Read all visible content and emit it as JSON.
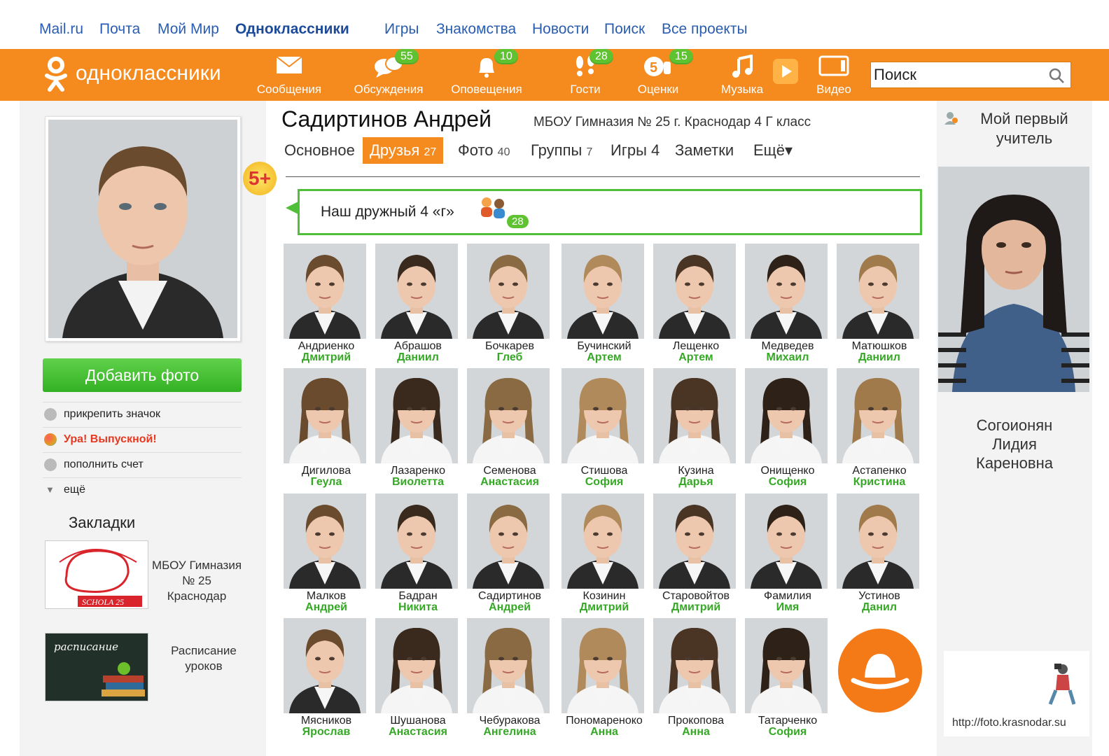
{
  "portal_nav": [
    "Mail.ru",
    "Почта",
    "Мой Мир",
    "Одноклассники",
    "Игры",
    "Знакомства",
    "Новости",
    "Поиск",
    "Все проекты"
  ],
  "header": {
    "logo_text": "одноклассники",
    "nav": [
      {
        "label": "Сообщения",
        "icon": "envelope-icon",
        "badge": ""
      },
      {
        "label": "Обсуждения",
        "icon": "chat-bubbles-icon",
        "badge": "55"
      },
      {
        "label": "Оповещения",
        "icon": "bell-icon",
        "badge": "10"
      },
      {
        "label": "Гости",
        "icon": "footprints-icon",
        "badge": "28"
      },
      {
        "label": "Оценки",
        "icon": "rating-icon",
        "badge": "15"
      },
      {
        "label": "Музыка",
        "icon": "music-note-icon",
        "badge": ""
      },
      {
        "label": "Видео",
        "icon": "video-icon",
        "badge": ""
      }
    ],
    "search_value": "Поиск"
  },
  "profile": {
    "name": "Садиртинов Андрей",
    "school": "МБОУ Гимназия № 25 г. Краснодар 4 Г класс",
    "age_badge": "5+",
    "add_photo": "Добавить фото",
    "menu": [
      "прикрепить значок",
      "Ура! Выпускной!",
      "пополнить счет",
      "ещё"
    ]
  },
  "bookmarks": {
    "title": "Закладки",
    "items": [
      {
        "text": "МБОУ Гимназия № 25 Краснодар",
        "image_text": "SCHOLA 25"
      },
      {
        "text": "Расписание уроков",
        "image_text": "расписание"
      }
    ]
  },
  "tabs": [
    {
      "label": "Основное",
      "count": ""
    },
    {
      "label": "Друзья",
      "count": "27"
    },
    {
      "label": "Фото",
      "count": "40"
    },
    {
      "label": "Группы",
      "count": "7"
    },
    {
      "label": "Игры",
      "count": "4"
    },
    {
      "label": "Заметки",
      "count": ""
    },
    {
      "label": "Ещё▾",
      "count": ""
    }
  ],
  "group": {
    "title": "Наш дружный 4 «г»",
    "count": "28"
  },
  "friends": [
    {
      "last": "Андриенко",
      "first": "Дмитрий"
    },
    {
      "last": "Абрашов",
      "first": "Даниил"
    },
    {
      "last": "Бочкарев",
      "first": "Глеб"
    },
    {
      "last": "Бучинский",
      "first": "Артем"
    },
    {
      "last": "Лещенко",
      "first": "Артем"
    },
    {
      "last": "Медведев",
      "first": "Михаил"
    },
    {
      "last": "Матюшков",
      "first": "Даниил"
    },
    {
      "last": "Дигилова",
      "first": "Геула"
    },
    {
      "last": "Лазаренко",
      "first": "Виолетта"
    },
    {
      "last": "Семенова",
      "first": "Анастасия"
    },
    {
      "last": "Стишова",
      "first": "София"
    },
    {
      "last": "Кузина",
      "first": "Дарья"
    },
    {
      "last": "Онищенко",
      "first": "София"
    },
    {
      "last": "Астапенко",
      "first": "Кристина"
    },
    {
      "last": "Малков",
      "first": "Андрей"
    },
    {
      "last": "Бадран",
      "first": "Никита"
    },
    {
      "last": "Садиртинов",
      "first": "Андрей"
    },
    {
      "last": "Козинин",
      "first": "Дмитрий"
    },
    {
      "last": "Старовойтов",
      "first": "Дмитрий"
    },
    {
      "last": "Фамилия",
      "first": "Имя"
    },
    {
      "last": "Устинов",
      "first": "Данил"
    },
    {
      "last": "Мясников",
      "first": "Ярослав"
    },
    {
      "last": "Шушанова",
      "first": "Анастасия"
    },
    {
      "last": "Чебуракова",
      "first": "Ангелина"
    },
    {
      "last": "Пономареноко",
      "first": "Анна"
    },
    {
      "last": "Прокопова",
      "first": "Анна"
    },
    {
      "last": "Татарченко",
      "first": "София"
    }
  ],
  "teacher": {
    "title": "Мой первый учитель",
    "name_lines": [
      "Согоионян",
      "Лидия",
      "Кареновна"
    ]
  },
  "watermark_url": "http://foto.krasnodar.su",
  "colors": {
    "brand_orange": "#f58a1f",
    "accent_green": "#35a825",
    "link_blue": "#2a5db0"
  }
}
